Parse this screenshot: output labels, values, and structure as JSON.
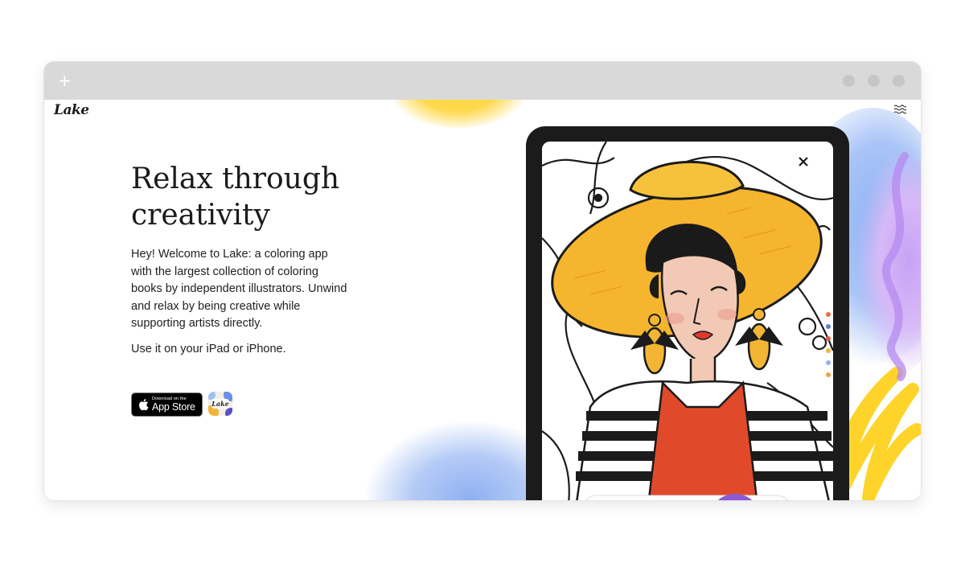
{
  "browser": {
    "new_tab_symbol": "+",
    "window_controls": [
      "minimize",
      "maximize",
      "close"
    ]
  },
  "site": {
    "logo_text": "Lake",
    "menu_icon": "waves-menu-icon"
  },
  "hero": {
    "headline_line1": "Relax through",
    "headline_line2": "creativity",
    "intro": "Hey! Welcome to Lake: a coloring app with the largest collection of coloring books by independent illustrators. Unwind and relax by being creative while supporting artists directly.",
    "device_line": "Use it on your iPad or iPhone."
  },
  "appstore": {
    "small_label": "Download on the",
    "big_label": "App Store",
    "icon": "apple-icon"
  },
  "app_icon": {
    "label": "Lake"
  },
  "illustration": {
    "description_icon": "woman-in-sun-hat-coloring-page",
    "palette_colors": [
      "#e8743b",
      "#5b7fd6",
      "#e05a4c",
      "#f0b43a",
      "#8fb3f5",
      "#f2a03d"
    ]
  },
  "colors": {
    "accent_yellow": "#ffd63a",
    "accent_blue": "#8fb3f5",
    "accent_purple": "#c8a2f5",
    "hat_orange": "#f5b52e",
    "lips_red": "#e03a2f",
    "apron_red": "#e04a2b"
  }
}
